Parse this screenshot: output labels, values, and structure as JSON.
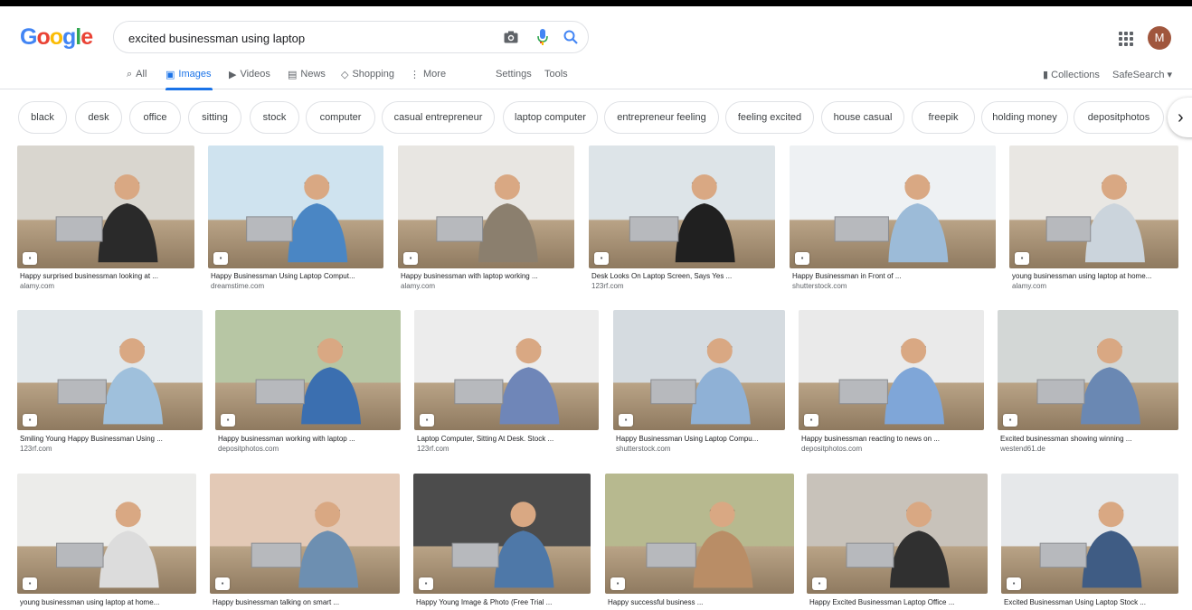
{
  "header": {
    "logo_text": "Google",
    "search": {
      "value": "excited businessman using laptop",
      "placeholder": ""
    },
    "avatar_letter": "M"
  },
  "tabs": [
    {
      "label": "All",
      "icon": "search-icon"
    },
    {
      "label": "Images",
      "icon": "image-icon"
    },
    {
      "label": "Videos",
      "icon": "video-icon"
    },
    {
      "label": "News",
      "icon": "news-icon"
    },
    {
      "label": "Shopping",
      "icon": "tag-icon"
    },
    {
      "label": "More",
      "icon": "more-icon"
    },
    {
      "label": "Settings",
      "icon": ""
    },
    {
      "label": "Tools",
      "icon": ""
    }
  ],
  "right_tools": {
    "collections": "Collections",
    "safesearch": "SafeSearch ▾"
  },
  "chips": [
    "black",
    "desk",
    "office",
    "sitting",
    "stock",
    "computer",
    "casual entrepreneur",
    "laptop computer",
    "entrepreneur feeling",
    "feeling excited",
    "house casual",
    "freepik",
    "holding money",
    "depositphotos"
  ],
  "results": [
    {
      "title": "Happy surprised businessman looking at ...",
      "source": "alamy.com"
    },
    {
      "title": "Happy Businessman Using Laptop Comput...",
      "source": "dreamstime.com"
    },
    {
      "title": "Happy businessman with laptop working ...",
      "source": "alamy.com"
    },
    {
      "title": "Desk Looks On Laptop Screen, Says Yes ...",
      "source": "123rf.com"
    },
    {
      "title": "Happy Businessman in Front of ...",
      "source": "shutterstock.com"
    },
    {
      "title": "young businessman using laptop at home...",
      "source": "alamy.com"
    },
    {
      "title": "Smiling Young Happy Businessman Using ...",
      "source": "123rf.com"
    },
    {
      "title": "Happy businessman working with laptop ...",
      "source": "depositphotos.com"
    },
    {
      "title": "Laptop Computer, Sitting At Desk. Stock ...",
      "source": "123rf.com"
    },
    {
      "title": "Happy Businessman Using Laptop Compu...",
      "source": "shutterstock.com"
    },
    {
      "title": "Happy businessman reacting to news on ...",
      "source": "depositphotos.com"
    },
    {
      "title": "Excited businessman showing winning ...",
      "source": "westend61.de"
    },
    {
      "title": "young businessman using laptop at home...",
      "source": ""
    },
    {
      "title": "Happy businessman talking on smart ...",
      "source": ""
    },
    {
      "title": "Happy Young Image & Photo (Free Trial ...",
      "source": ""
    },
    {
      "title": "Happy successful business ...",
      "source": ""
    },
    {
      "title": "Happy Excited Businessman Laptop Office ...",
      "source": ""
    },
    {
      "title": "Excited Businessman Using Laptop Stock ...",
      "source": ""
    }
  ],
  "colors": {
    "accent": "#1a73e8",
    "text_secondary": "#5f6368",
    "border": "#dfe1e5"
  }
}
